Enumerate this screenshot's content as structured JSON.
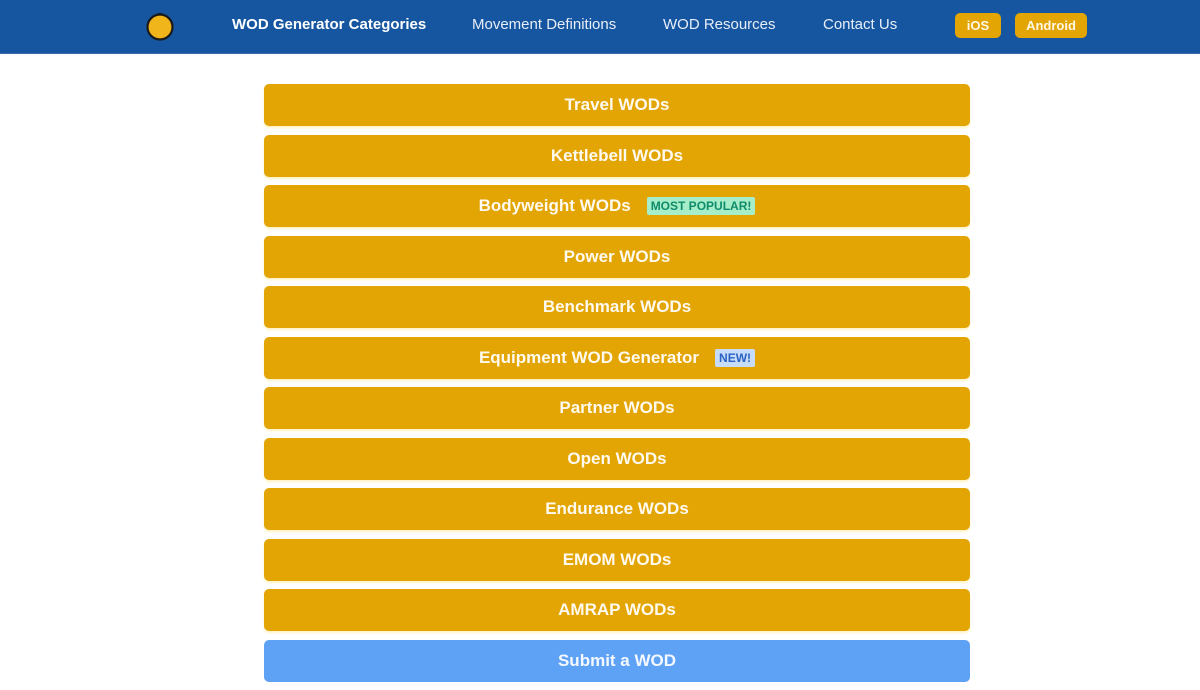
{
  "navbar": {
    "logo": "kettlebell-logo",
    "links": [
      {
        "label": "WOD Generator Categories",
        "active": true
      },
      {
        "label": "Movement Definitions",
        "active": false
      },
      {
        "label": "WOD Resources",
        "active": false
      },
      {
        "label": "Contact Us",
        "active": false
      }
    ],
    "store_buttons": [
      {
        "label": "iOS"
      },
      {
        "label": "Android"
      }
    ]
  },
  "categories": [
    {
      "label": "Travel WODs"
    },
    {
      "label": "Kettlebell WODs"
    },
    {
      "label": "Bodyweight WODs",
      "badge": "MOST POPULAR!"
    },
    {
      "label": "Power WODs"
    },
    {
      "label": "Benchmark WODs"
    },
    {
      "label": "Equipment WOD Generator",
      "badge": "NEW!"
    },
    {
      "label": "Partner WODs"
    },
    {
      "label": "Open WODs"
    },
    {
      "label": "Endurance WODs"
    },
    {
      "label": "EMOM WODs"
    },
    {
      "label": "AMRAP WODs"
    }
  ],
  "submit": {
    "label": "Submit a WOD"
  },
  "colors": {
    "navbar": "#1656a0",
    "category_button": "#e3a504",
    "submit_button": "#5ea2f6",
    "badge_popular_bg": "#a6eec9",
    "badge_new_bg": "#c6dcf8"
  }
}
